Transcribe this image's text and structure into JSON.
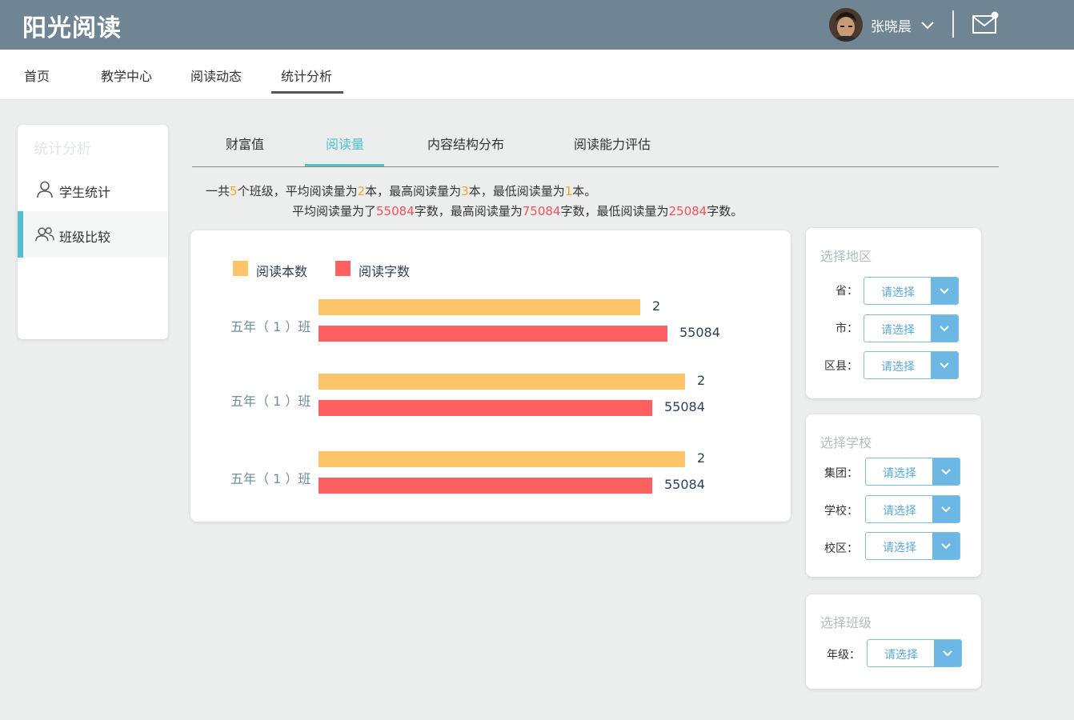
{
  "header": {
    "logo": "阳光阅读",
    "username": "张晓晨",
    "icons": [
      "avatar",
      "chevron-down-icon",
      "mail-icon"
    ]
  },
  "nav": {
    "items": [
      "首页",
      "教学中心",
      "阅读动态",
      "统计分析"
    ],
    "active": "统计分析"
  },
  "sidebar": {
    "title": "统计分析",
    "items": [
      {
        "label": "学生统计",
        "icon": "user-icon"
      },
      {
        "label": "班级比较",
        "icon": "users-icon"
      }
    ],
    "active": "班级比较"
  },
  "tabs": {
    "items": [
      "财富值",
      "阅读量",
      "内容结构分布",
      "阅读能力评估"
    ],
    "active": "阅读量"
  },
  "summary": {
    "line1": {
      "p1": "一共",
      "class_count": "5",
      "p2": "个班级，平均阅读量为",
      "avg_books": "2",
      "p3": "本，最高阅读量为",
      "max_books": "3",
      "p4": "本，最低阅读量为",
      "min_books": "1",
      "p5": "本。"
    },
    "line2": {
      "p1": "平均阅读量为了",
      "avg_words": "55084",
      "p2": "字数，最高阅读量为",
      "max_words": "75084",
      "p3": "字数，最低阅读量为",
      "min_words": "25084",
      "p4": "字数。"
    }
  },
  "colors": {
    "books": "#fec46a",
    "words": "#fe5f61",
    "accent": "#52bfcf",
    "header_bg": "#6f8593"
  },
  "chart_data": {
    "type": "bar",
    "orientation": "horizontal",
    "title": "",
    "categories": [
      "五年（1）班",
      "五年（1）班",
      "五年（1）班"
    ],
    "series": [
      {
        "name": "阅读本数",
        "values": [
          2,
          2,
          2
        ]
      },
      {
        "name": "阅读字数",
        "values": [
          55084,
          55084,
          55084
        ]
      }
    ],
    "legend": "top-left",
    "grid": false
  },
  "filters": {
    "region": {
      "title": "选择地区",
      "rows": [
        {
          "label": "省：",
          "value": "请选择"
        },
        {
          "label": "市：",
          "value": "请选择"
        },
        {
          "label": "区县：",
          "value": "请选择"
        }
      ]
    },
    "school": {
      "title": "选择学校",
      "rows": [
        {
          "label": "集团：",
          "value": "请选择"
        },
        {
          "label": "学校：",
          "value": "请选择"
        },
        {
          "label": "校区：",
          "value": "请选择"
        }
      ]
    },
    "class": {
      "title": "选择班级",
      "rows": [
        {
          "label": "年级：",
          "value": "请选择"
        }
      ]
    }
  }
}
